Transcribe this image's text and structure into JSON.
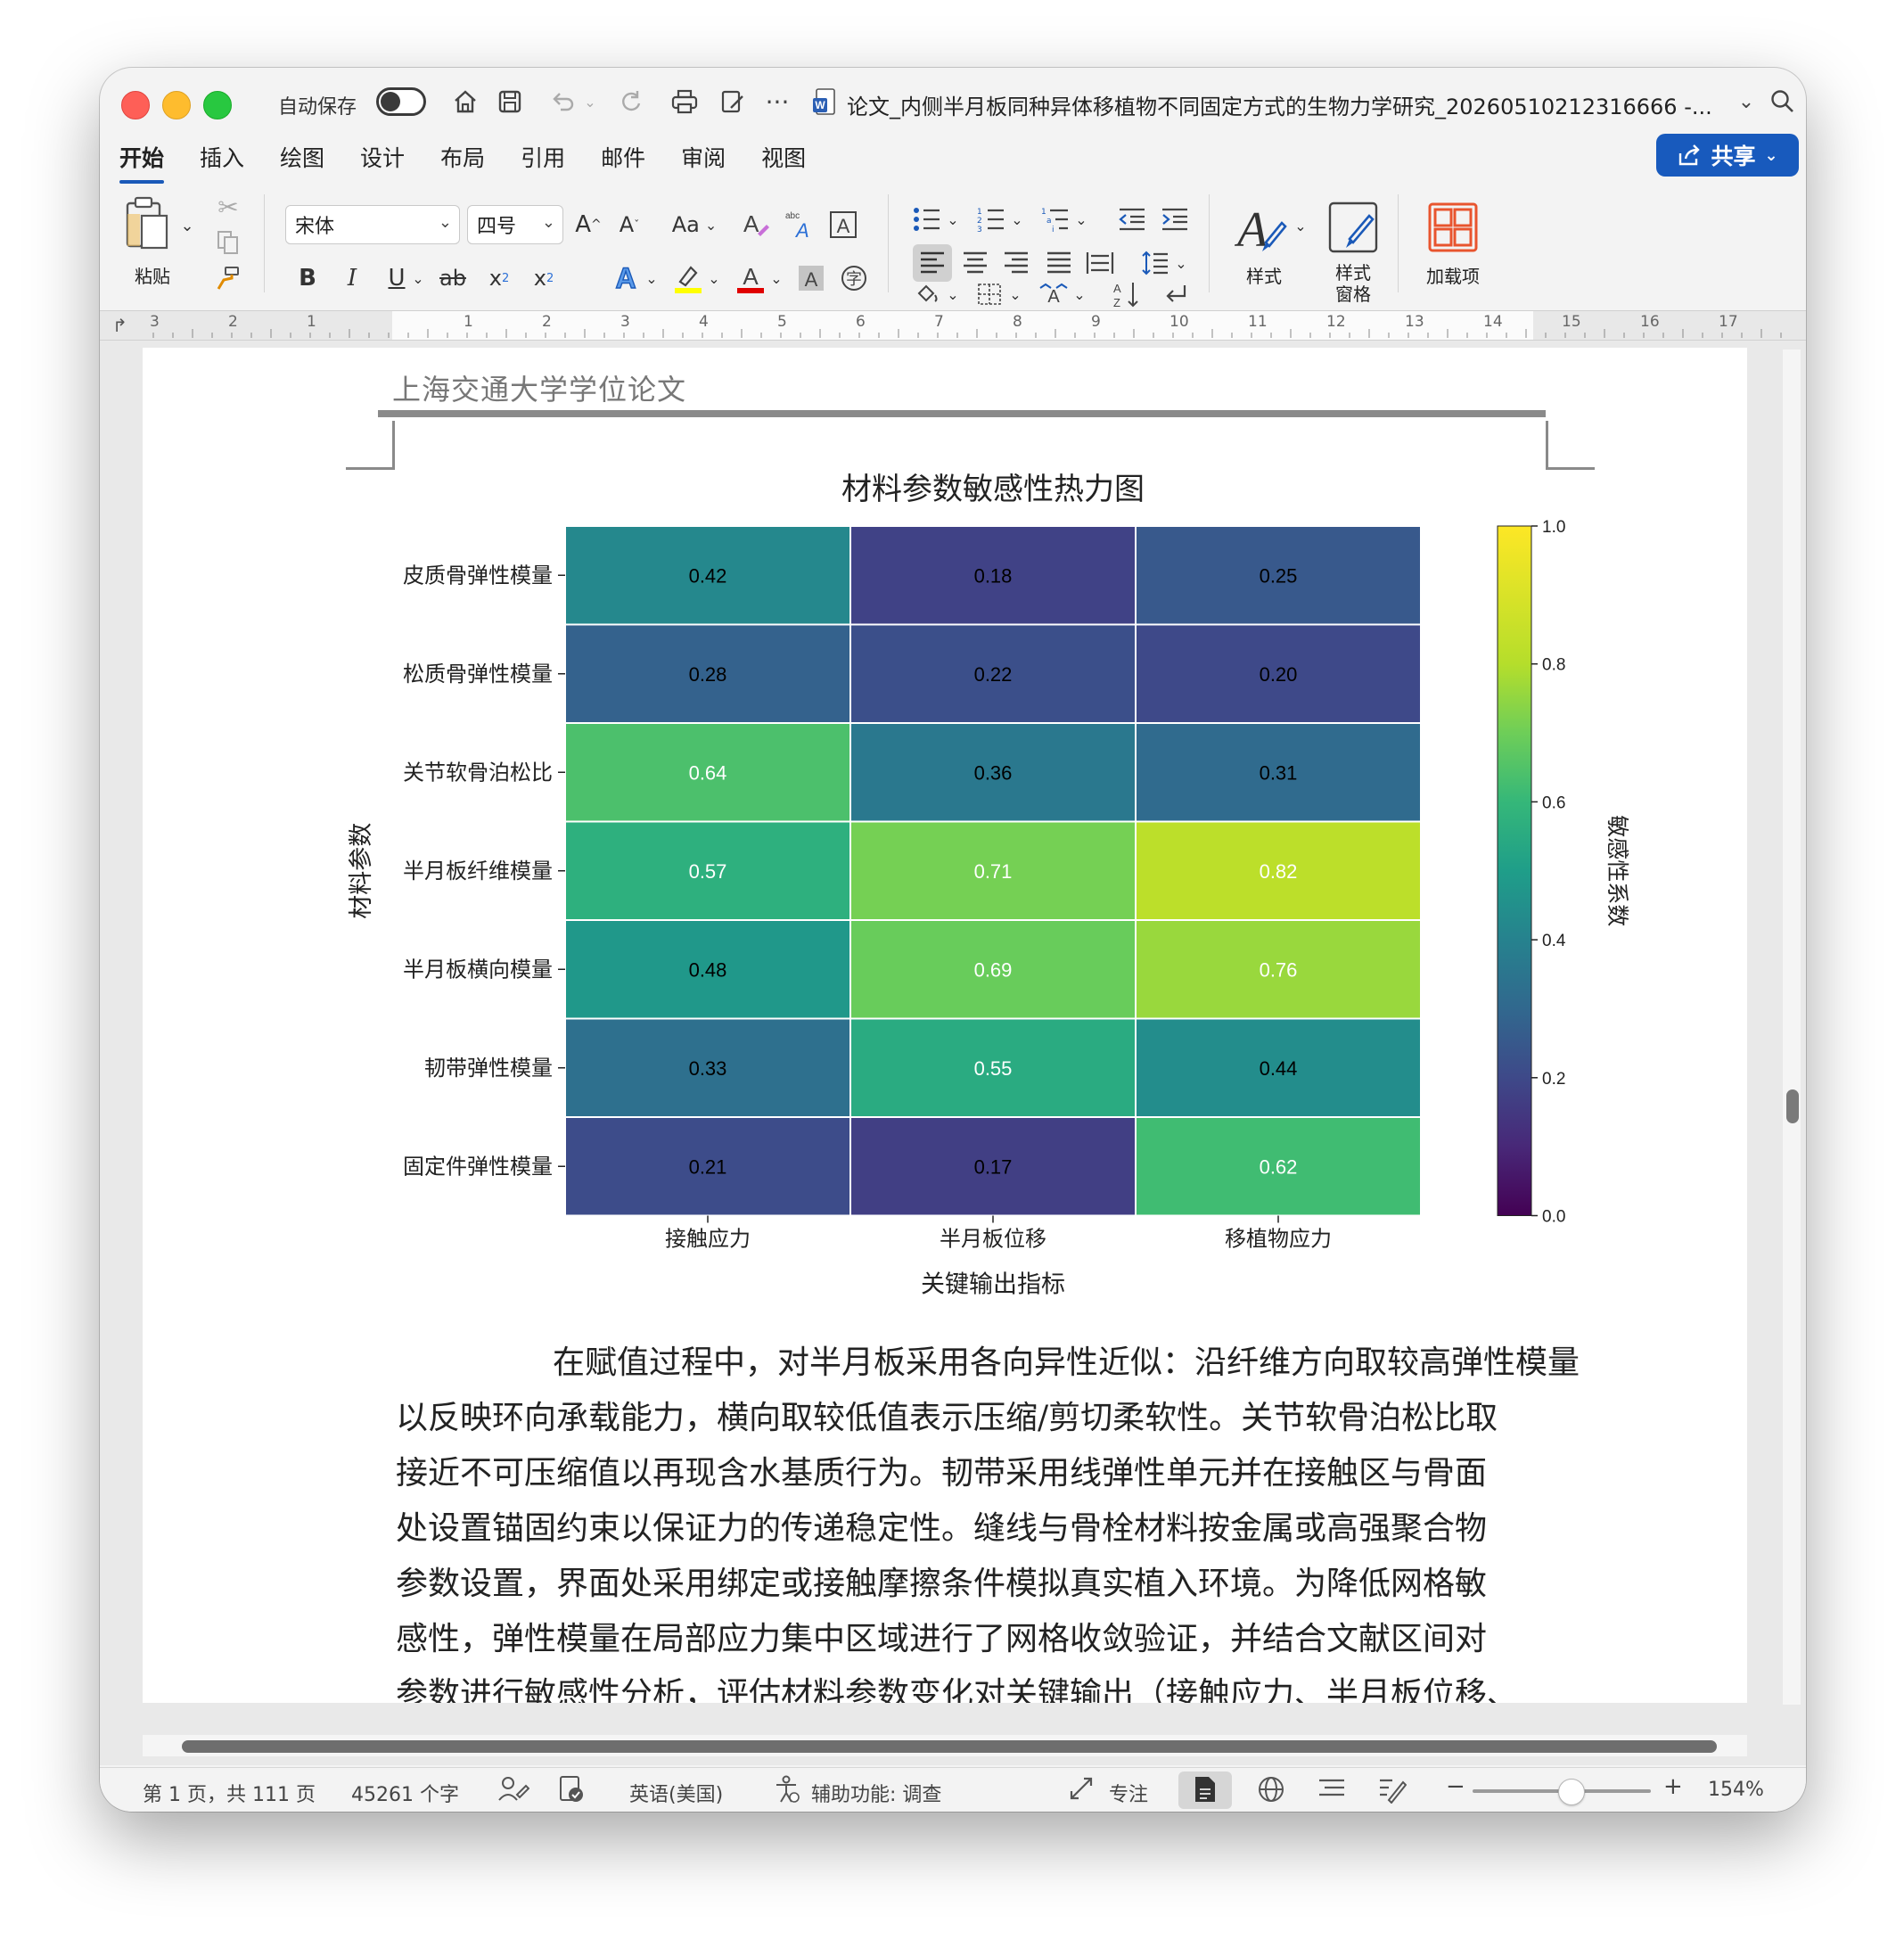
{
  "titlebar": {
    "autosave_label": "自动保存",
    "doc_title": "论文_内侧半月板同种异体移植物不同固定方式的生物力学研究_20260510212316666 -..."
  },
  "tabs": [
    "开始",
    "插入",
    "绘图",
    "设计",
    "布局",
    "引用",
    "邮件",
    "审阅",
    "视图"
  ],
  "share_label": "共享",
  "ribbon": {
    "paste_label": "粘贴",
    "font_name": "宋体",
    "font_size": "四号",
    "styles_label": "样式",
    "styles_pane_label": "样式\n窗格",
    "styles_pane_line1": "样式",
    "styles_pane_line2": "窗格",
    "addins_label": "加载项",
    "change_case_label": "Aa"
  },
  "ruler": {
    "left_numbers": [
      "3",
      "2",
      "1"
    ],
    "right_numbers": [
      "1",
      "2",
      "3",
      "4",
      "5",
      "6",
      "7",
      "8",
      "9",
      "10",
      "11",
      "12",
      "13",
      "14",
      "15",
      "16",
      "17"
    ]
  },
  "document": {
    "header_text": "上海交通大学学位论文",
    "body_lines": [
      "在赋值过程中，对半月板采用各向异性近似：沿纤维方向取较高弹性模量",
      "以反映环向承载能力，横向取较低值表示压缩/剪切柔软性。关节软骨泊松比取",
      "接近不可压缩值以再现含水基质行为。韧带采用线弹性单元并在接触区与骨面",
      "处设置锚固约束以保证力的传递稳定性。缝线与骨栓材料按金属或高强聚合物",
      "参数设置，界面处采用绑定或接触摩擦条件模拟真实植入环境。为降低网格敏",
      "感性，弹性模量在局部应力集中区域进行了网格收敛验证，并结合文献区间对",
      "参数进行敏感性分析，评估材料参数变化对关键输出（接触应力、半月板位移、"
    ]
  },
  "chart_data": {
    "type": "heatmap",
    "title": "材料参数敏感性热力图",
    "xlabel": "关键输出指标",
    "ylabel": "材料参数",
    "x_categories": [
      "接触应力",
      "半月板位移",
      "移植物应力"
    ],
    "y_categories": [
      "皮质骨弹性模量",
      "松质骨弹性模量",
      "关节软骨泊松比",
      "半月板纤维模量",
      "半月板横向模量",
      "韧带弹性模量",
      "固定件弹性模量"
    ],
    "values": [
      [
        0.42,
        0.18,
        0.25
      ],
      [
        0.28,
        0.22,
        0.2
      ],
      [
        0.64,
        0.36,
        0.31
      ],
      [
        0.57,
        0.71,
        0.82
      ],
      [
        0.48,
        0.69,
        0.76
      ],
      [
        0.33,
        0.55,
        0.44
      ],
      [
        0.21,
        0.17,
        0.62
      ]
    ],
    "cell_labels": [
      [
        "0.42",
        "0.18",
        "0.25"
      ],
      [
        "0.28",
        "0.22",
        "0.20"
      ],
      [
        "0.64",
        "0.36",
        "0.31"
      ],
      [
        "0.57",
        "0.71",
        "0.82"
      ],
      [
        "0.48",
        "0.69",
        "0.76"
      ],
      [
        "0.33",
        "0.55",
        "0.44"
      ],
      [
        "0.21",
        "0.17",
        "0.62"
      ]
    ],
    "colormap": "viridis",
    "colorbar_label": "敏感性系数",
    "colorbar_range": [
      0.0,
      1.0
    ],
    "colorbar_ticks": [
      "0.0",
      "0.2",
      "0.4",
      "0.6",
      "0.8",
      "1.0"
    ],
    "label_light_color": "#ffffff",
    "label_dark_color": "#000000"
  },
  "status": {
    "page_info": "第 1 页，共 111 页",
    "word_count": "45261 个字",
    "language": "英语(美国)",
    "accessibility": "辅助功能: 调查",
    "focus_label": "专注",
    "zoom_minus": "−",
    "zoom_plus": "+",
    "zoom_level": "154%"
  },
  "colors": {
    "accent": "#185abd",
    "highlight_yellow": "#ffff00",
    "font_color_red": "#e00000",
    "addins_orange": "#e8542e"
  }
}
